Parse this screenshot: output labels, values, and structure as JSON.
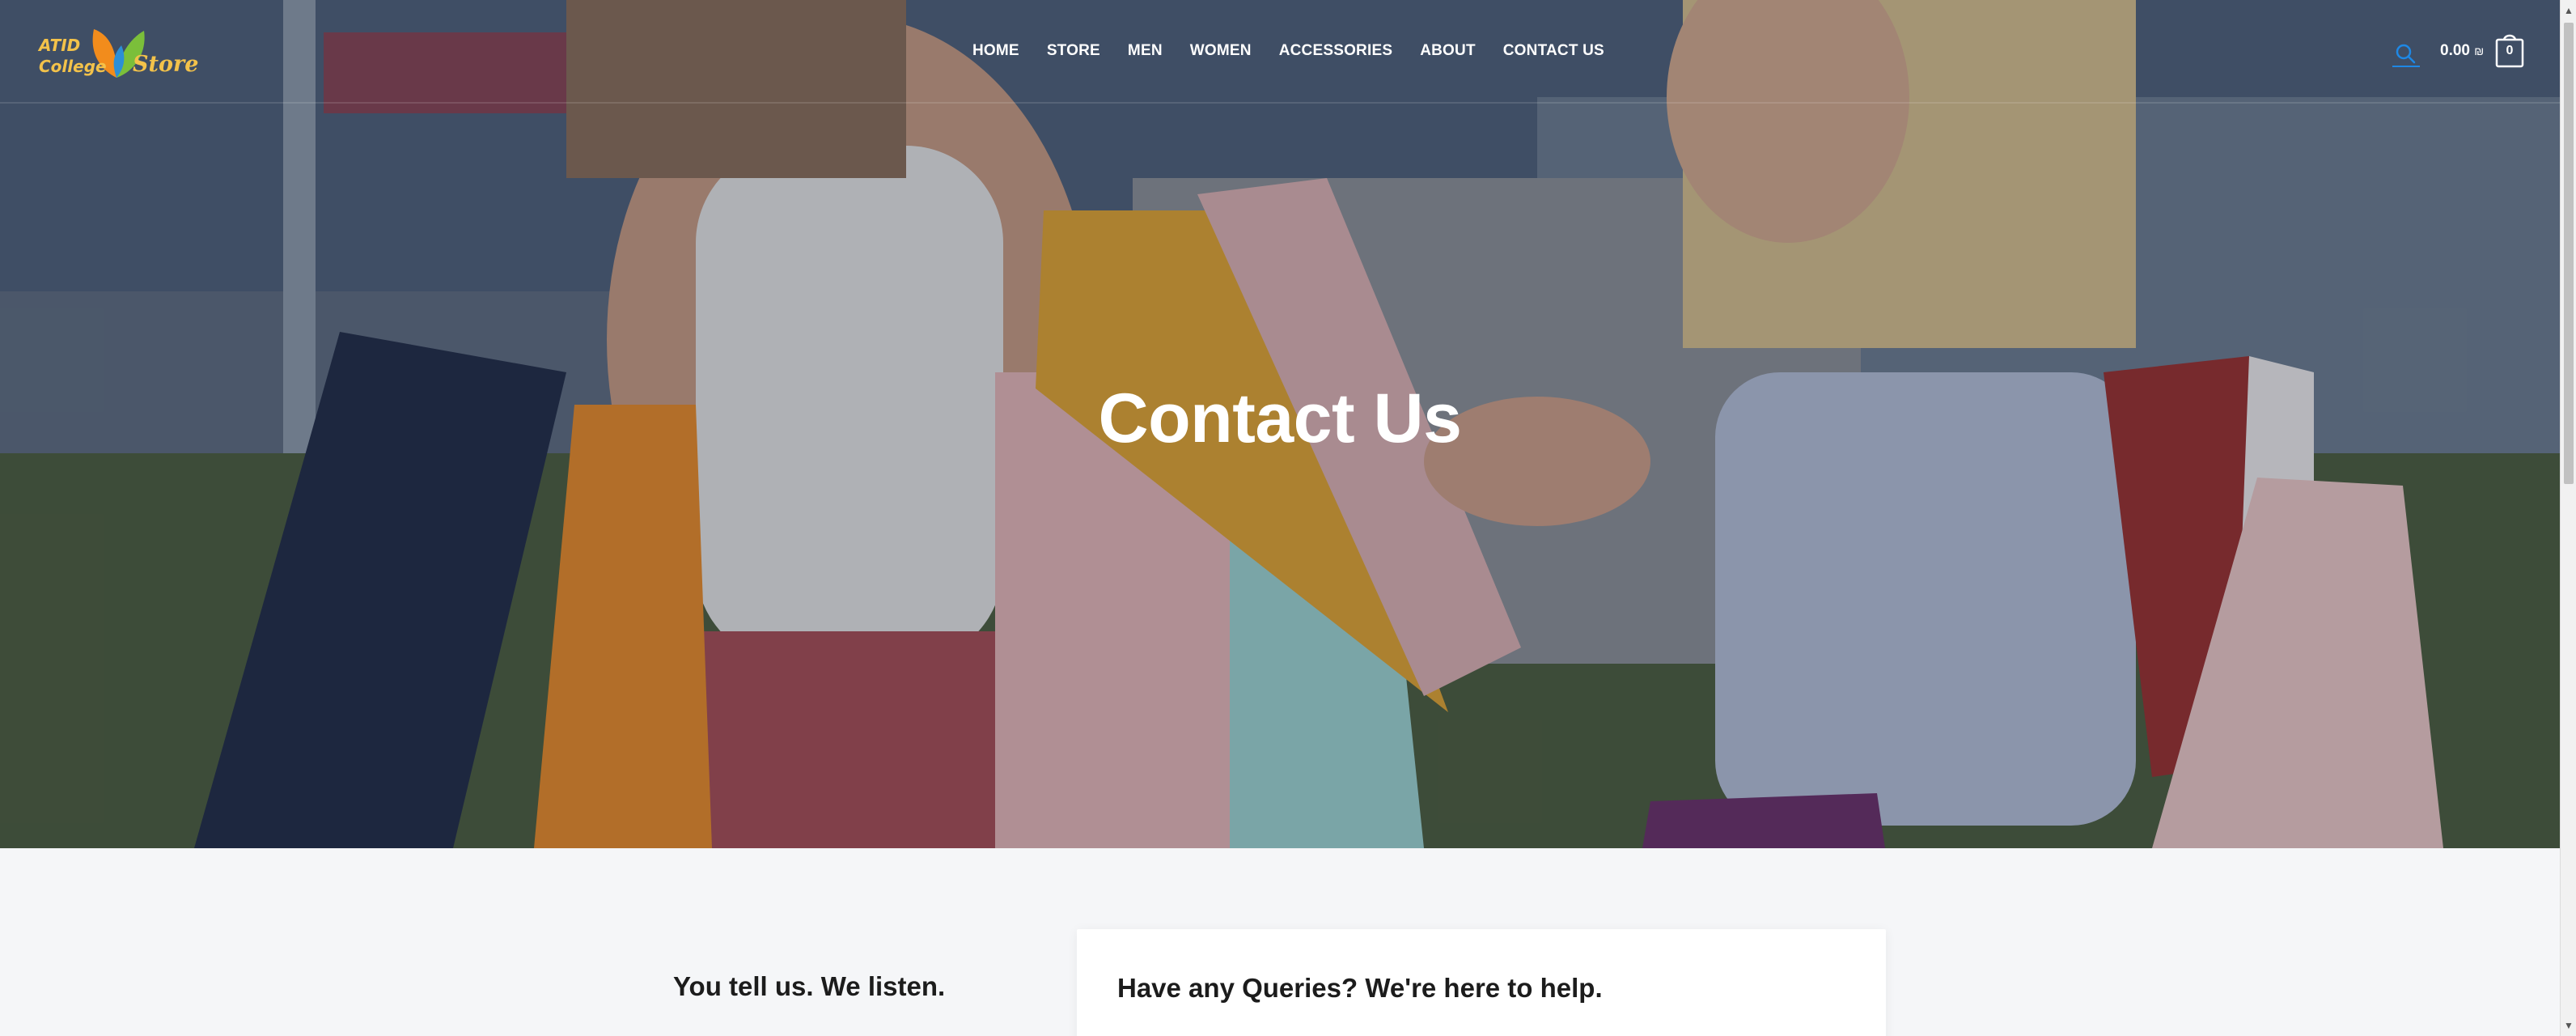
{
  "brand": {
    "line1": "ATID",
    "line2": "College",
    "line3": "Store"
  },
  "nav": {
    "items": [
      "HOME",
      "STORE",
      "MEN",
      "WOMEN",
      "ACCESSORIES",
      "ABOUT",
      "CONTACT US"
    ]
  },
  "header": {
    "search_icon": "search-icon",
    "cart_amount": "0.00",
    "cart_currency": "₪",
    "cart_count": "0",
    "accent_color": "#1e88e5"
  },
  "hero": {
    "title": "Contact Us"
  },
  "content": {
    "left_heading": "You tell us. We listen.",
    "card_heading": "Have any Queries? We're here to help."
  }
}
